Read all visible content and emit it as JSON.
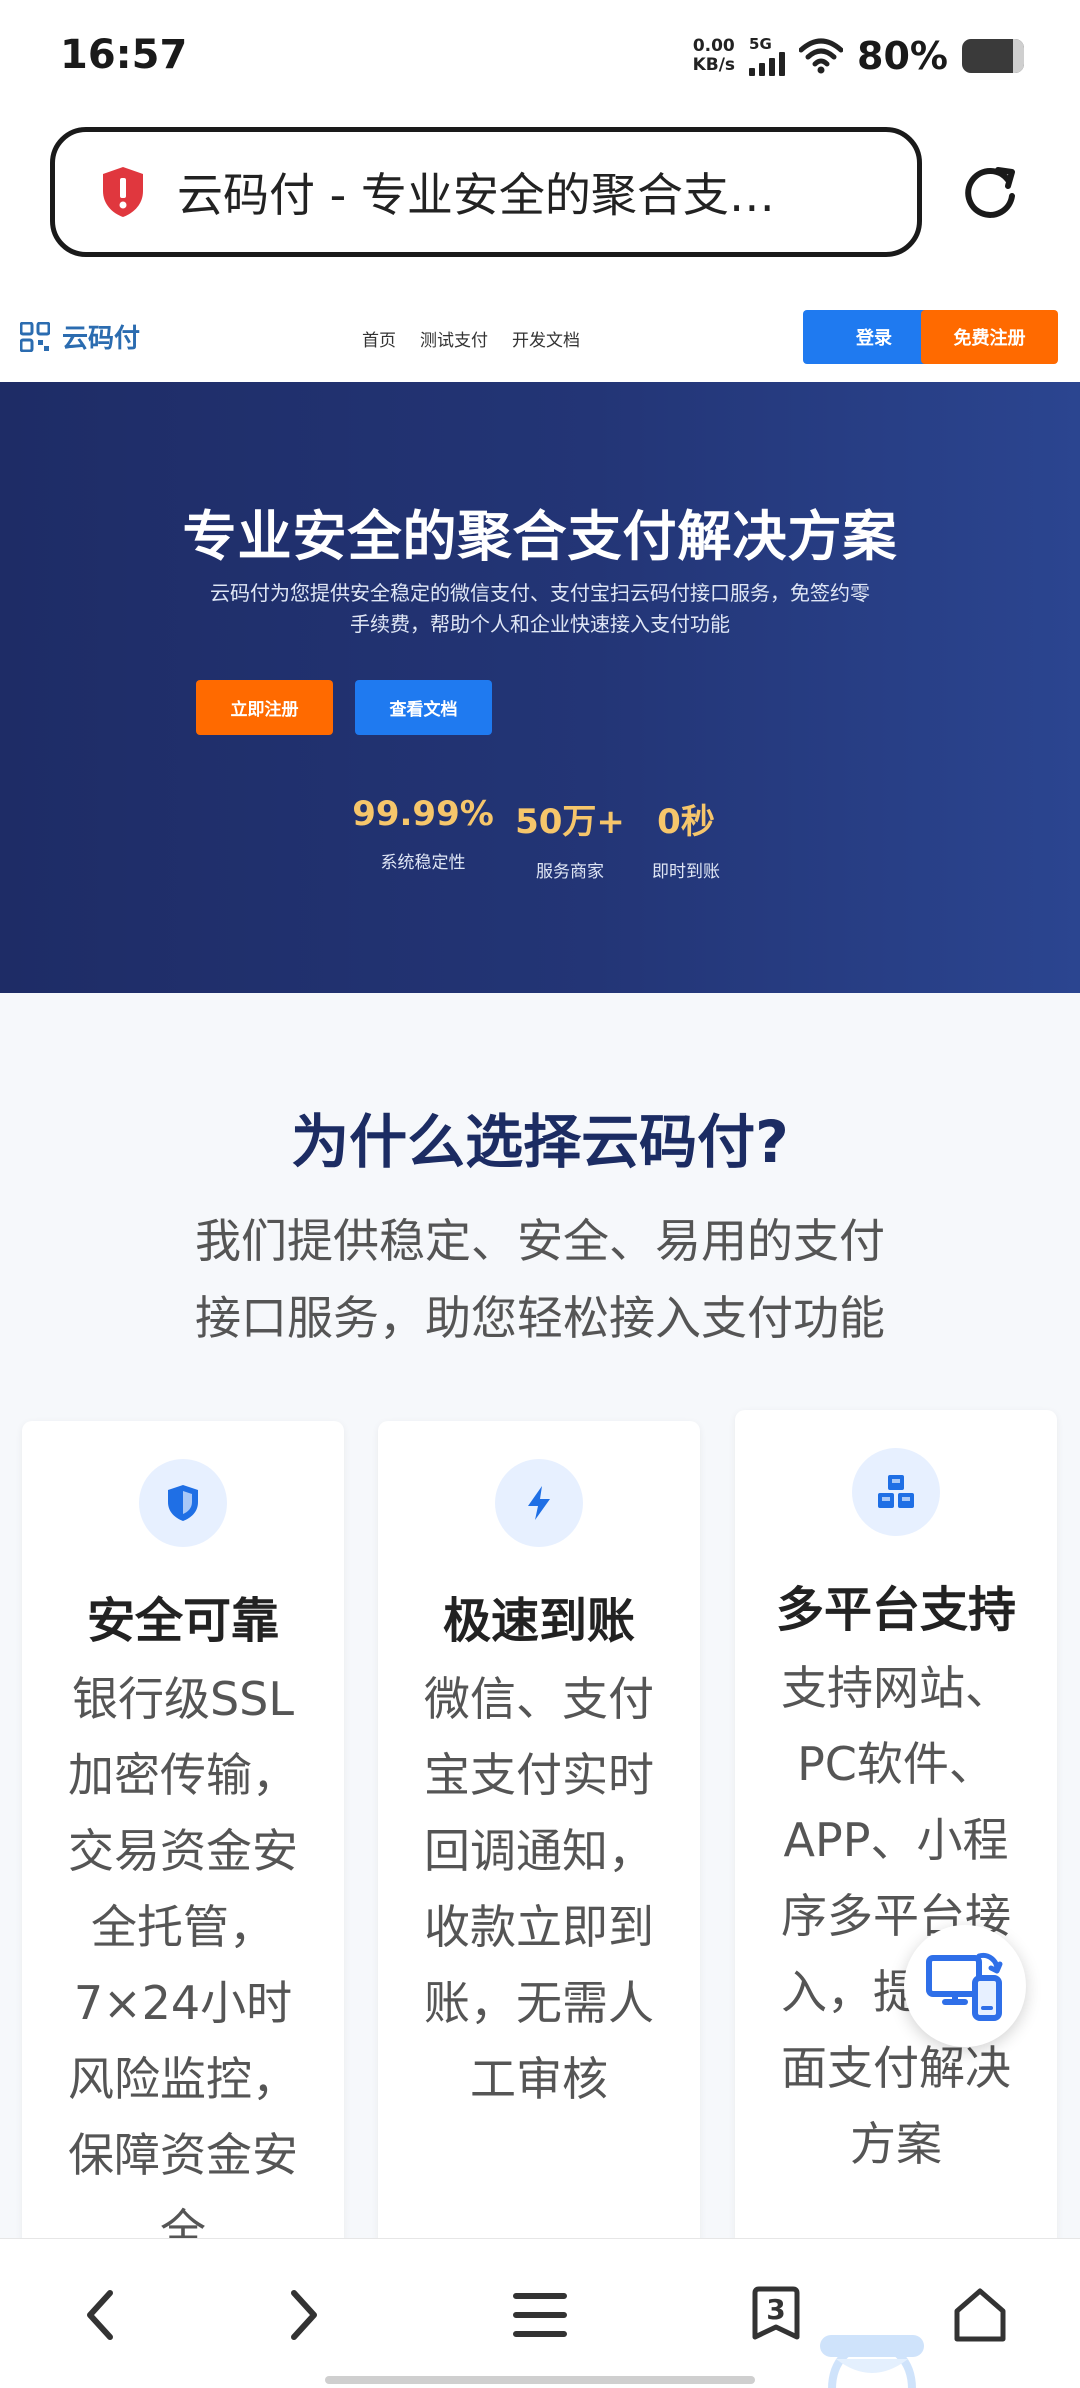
{
  "status_bar": {
    "time": "16:57",
    "net_speed_value": "0.00",
    "net_speed_unit": "KB/s",
    "network": "5G",
    "battery": "80%"
  },
  "browser": {
    "address_text": "云码付 - 专业安全的聚合支…",
    "tab_count": "3"
  },
  "nav": {
    "logo": "云码付",
    "links": [
      "首页",
      "测试支付",
      "开发文档"
    ],
    "login": "登录",
    "register": "免费注册"
  },
  "hero": {
    "title": "专业安全的聚合支付解决方案",
    "subtitle_line1": "云码付为您提供安全稳定的微信支付、支付宝扫云码付接口服务，免签约零",
    "subtitle_line2": "手续费，帮助个人和企业快速接入支付功能",
    "primary_button": "立即注册",
    "secondary_button": "查看文档",
    "stats": [
      {
        "value": "99.99%",
        "label": "系统稳定性"
      },
      {
        "value": "50万+",
        "label": "服务商家"
      },
      {
        "value": "0秒",
        "label": "即时到账"
      }
    ]
  },
  "why": {
    "title": "为什么选择云码付?",
    "subtitle_line1": "我们提供稳定、安全、易用的支付",
    "subtitle_line2": "接口服务，助您轻松接入支付功能",
    "cards": [
      {
        "icon": "shield-icon",
        "title": "安全可靠",
        "desc": [
          "银行级SSL",
          "加密传输，",
          "交易资金安",
          "全托管，",
          "7×24小时",
          "风险监控，",
          "保障资金安",
          "全"
        ]
      },
      {
        "icon": "lightning-icon",
        "title": "极速到账",
        "desc": [
          "微信、支付",
          "宝支付实时",
          "回调通知，",
          "收款立即到",
          "账，无需人",
          "工审核"
        ]
      },
      {
        "icon": "cubes-icon",
        "title": "多平台支持",
        "desc": [
          "支持网站、",
          "PC软件、",
          "APP、小程",
          "序多平台接",
          "入，提供全",
          "面支付解决",
          "方案"
        ]
      }
    ]
  },
  "colors": {
    "brand_blue": "#1f7af0",
    "brand_orange": "#ff6a00",
    "hero_bg": "#233576",
    "stat_gold": "#f6c66b",
    "heading_navy": "#1c2c63"
  }
}
